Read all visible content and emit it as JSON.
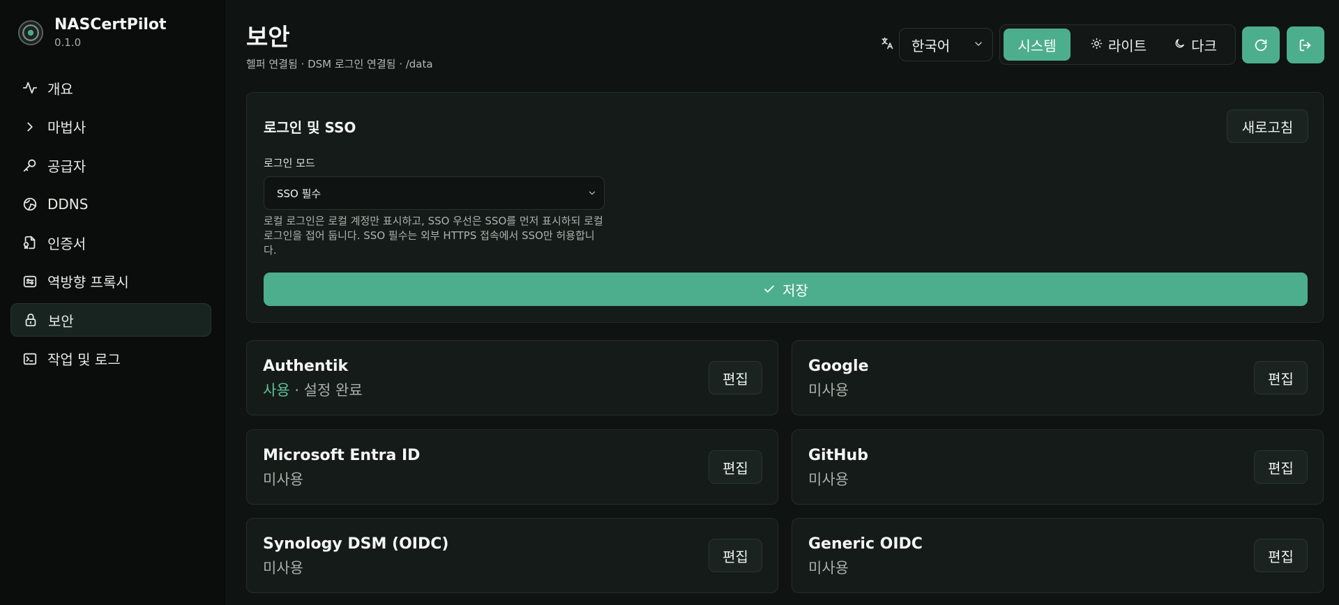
{
  "brand": {
    "title": "NASCertPilot",
    "version": "0.1.0"
  },
  "nav": {
    "items": [
      {
        "label": "개요",
        "icon": "activity-icon"
      },
      {
        "label": "마법사",
        "icon": "chevron-right-icon"
      },
      {
        "label": "공급자",
        "icon": "key-icon"
      },
      {
        "label": "DDNS",
        "icon": "globe-icon"
      },
      {
        "label": "인증서",
        "icon": "file-certificate-icon"
      },
      {
        "label": "역방향 프록시",
        "icon": "proxy-icon"
      },
      {
        "label": "보안",
        "icon": "lock-icon",
        "active": true
      },
      {
        "label": "작업 및 로그",
        "icon": "terminal-icon"
      }
    ]
  },
  "header": {
    "title": "보안",
    "subtitle": "헬퍼 연결됨 · DSM 로그인 연결됨 · /data",
    "language": "한국어",
    "language_icon": "translate-icon",
    "theme": {
      "system": "시스템",
      "light": "라이트",
      "dark": "다크",
      "active": "system"
    },
    "accent": "#4dae8d"
  },
  "login": {
    "title": "로그인 및 SSO",
    "refresh_label": "새로고침",
    "mode_label": "로그인 모드",
    "mode_value": "SSO 필수",
    "help": "로컬 로그인은 로컬 계정만 표시하고, SSO 우선은 SSO를 먼저 표시하되 로컬 로그인을 접어 둡니다. SSO 필수는 외부 HTTPS 접속에서 SSO만 허용합니다.",
    "save_label": "저장"
  },
  "providers": [
    {
      "name": "Authentik",
      "enabled_label": "사용",
      "status": "· 설정 완료",
      "edit": "편집"
    },
    {
      "name": "Google",
      "status": "미사용",
      "edit": "편집"
    },
    {
      "name": "Microsoft Entra ID",
      "status": "미사용",
      "edit": "편집"
    },
    {
      "name": "GitHub",
      "status": "미사용",
      "edit": "편집"
    },
    {
      "name": "Synology DSM (OIDC)",
      "status": "미사용",
      "edit": "편집"
    },
    {
      "name": "Generic OIDC",
      "status": "미사용",
      "edit": "편집"
    }
  ]
}
